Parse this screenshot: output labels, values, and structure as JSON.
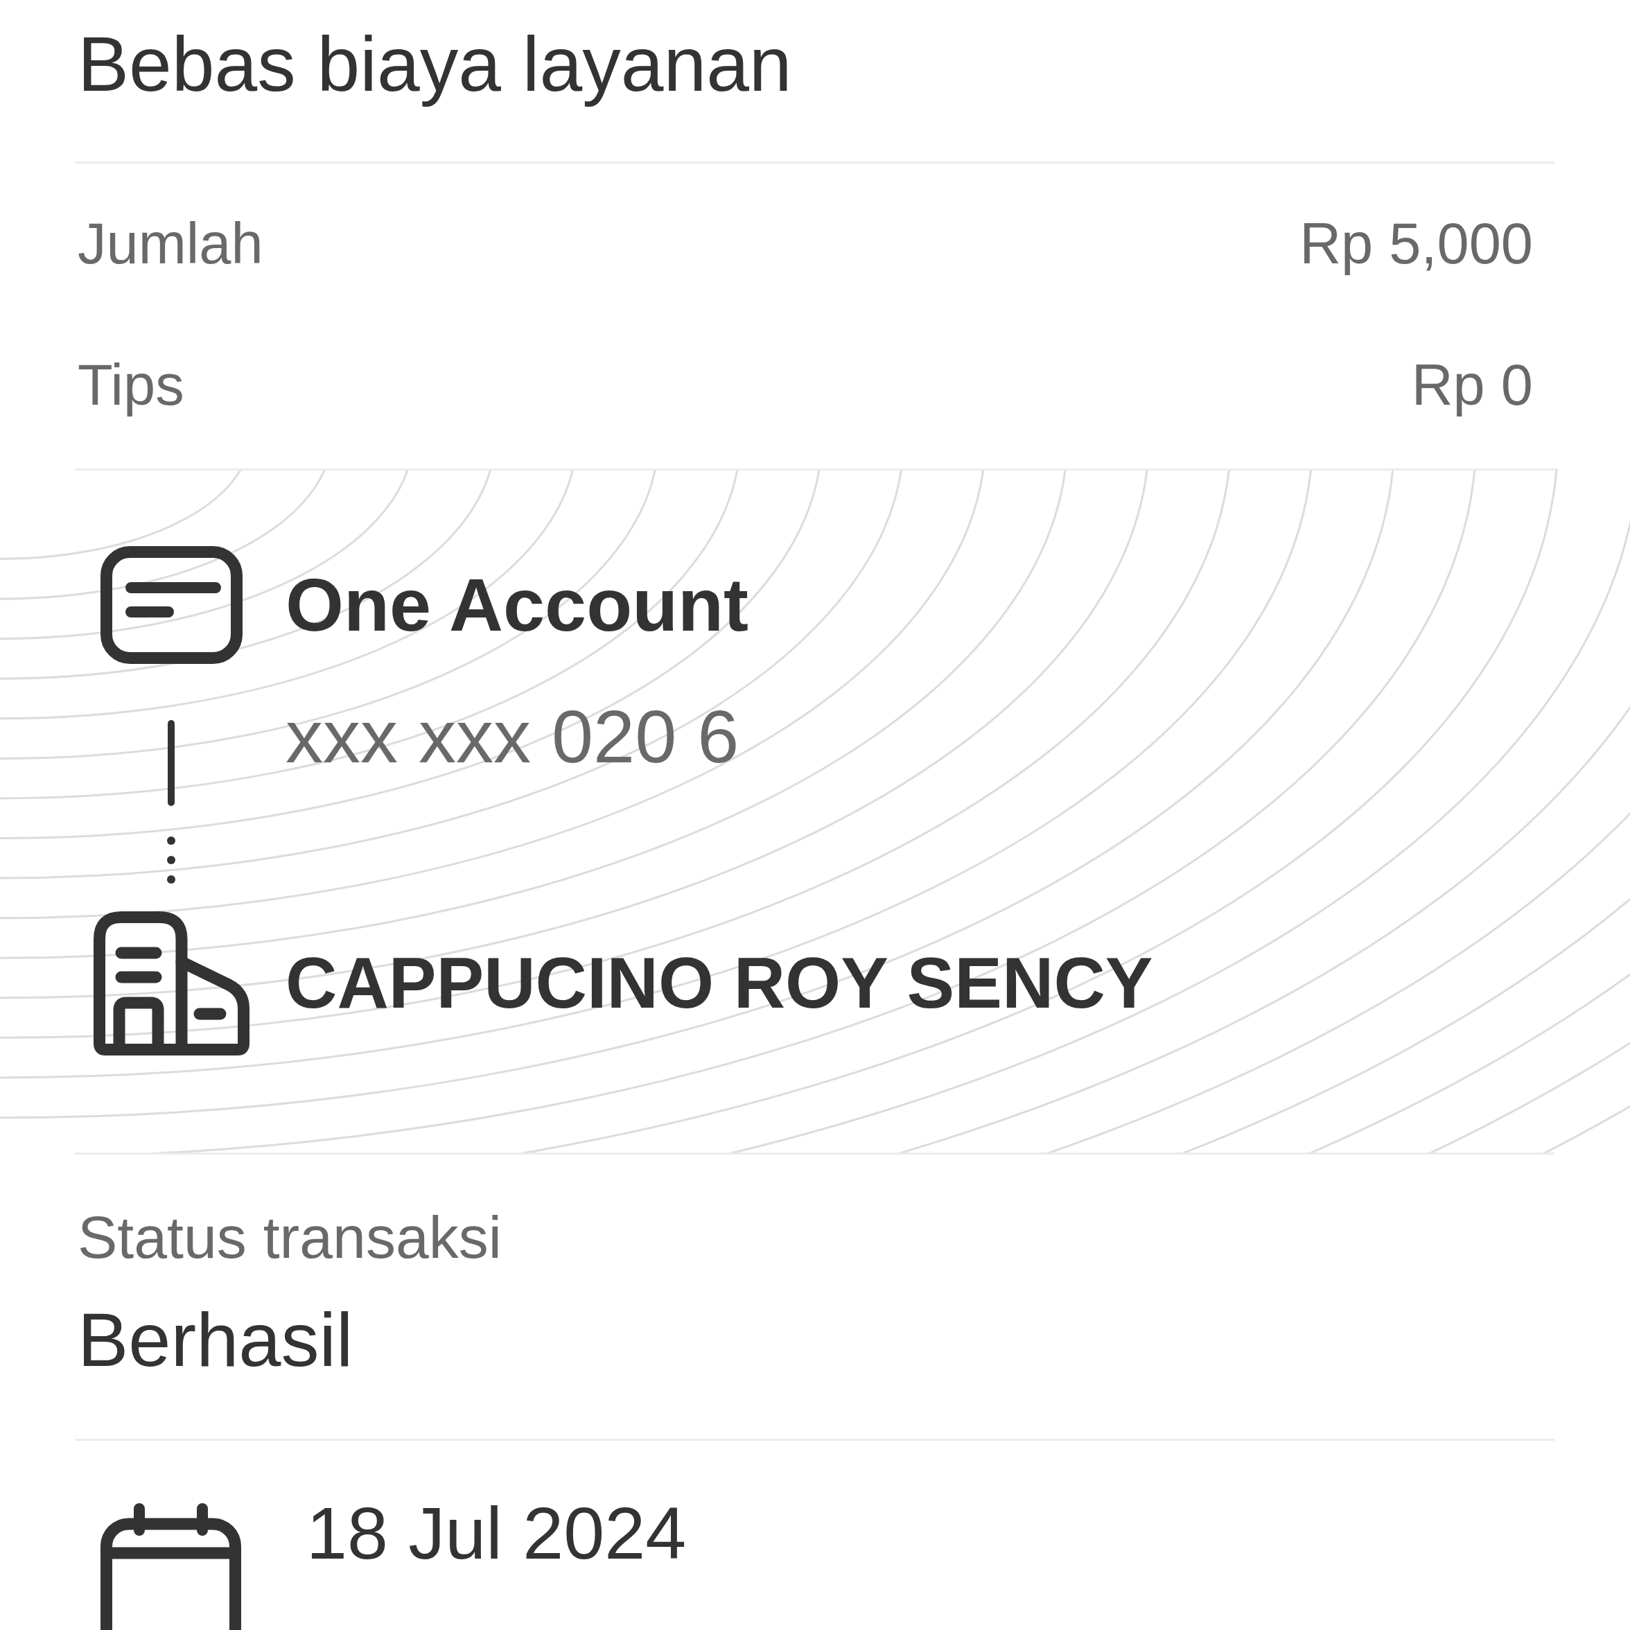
{
  "fee_note": "Bebas biaya layanan",
  "amounts": [
    {
      "label": "Jumlah",
      "value": "Rp 5,000"
    },
    {
      "label": "Tips",
      "value": "Rp 0"
    }
  ],
  "transfer": {
    "source": {
      "name": "One Account",
      "account_number": "xxx xxx 020 6"
    },
    "destination": {
      "name": "CAPPUCINO ROY SENCY"
    }
  },
  "status": {
    "label": "Status transaksi",
    "value": "Berhasil"
  },
  "date": "18 Jul 2024"
}
